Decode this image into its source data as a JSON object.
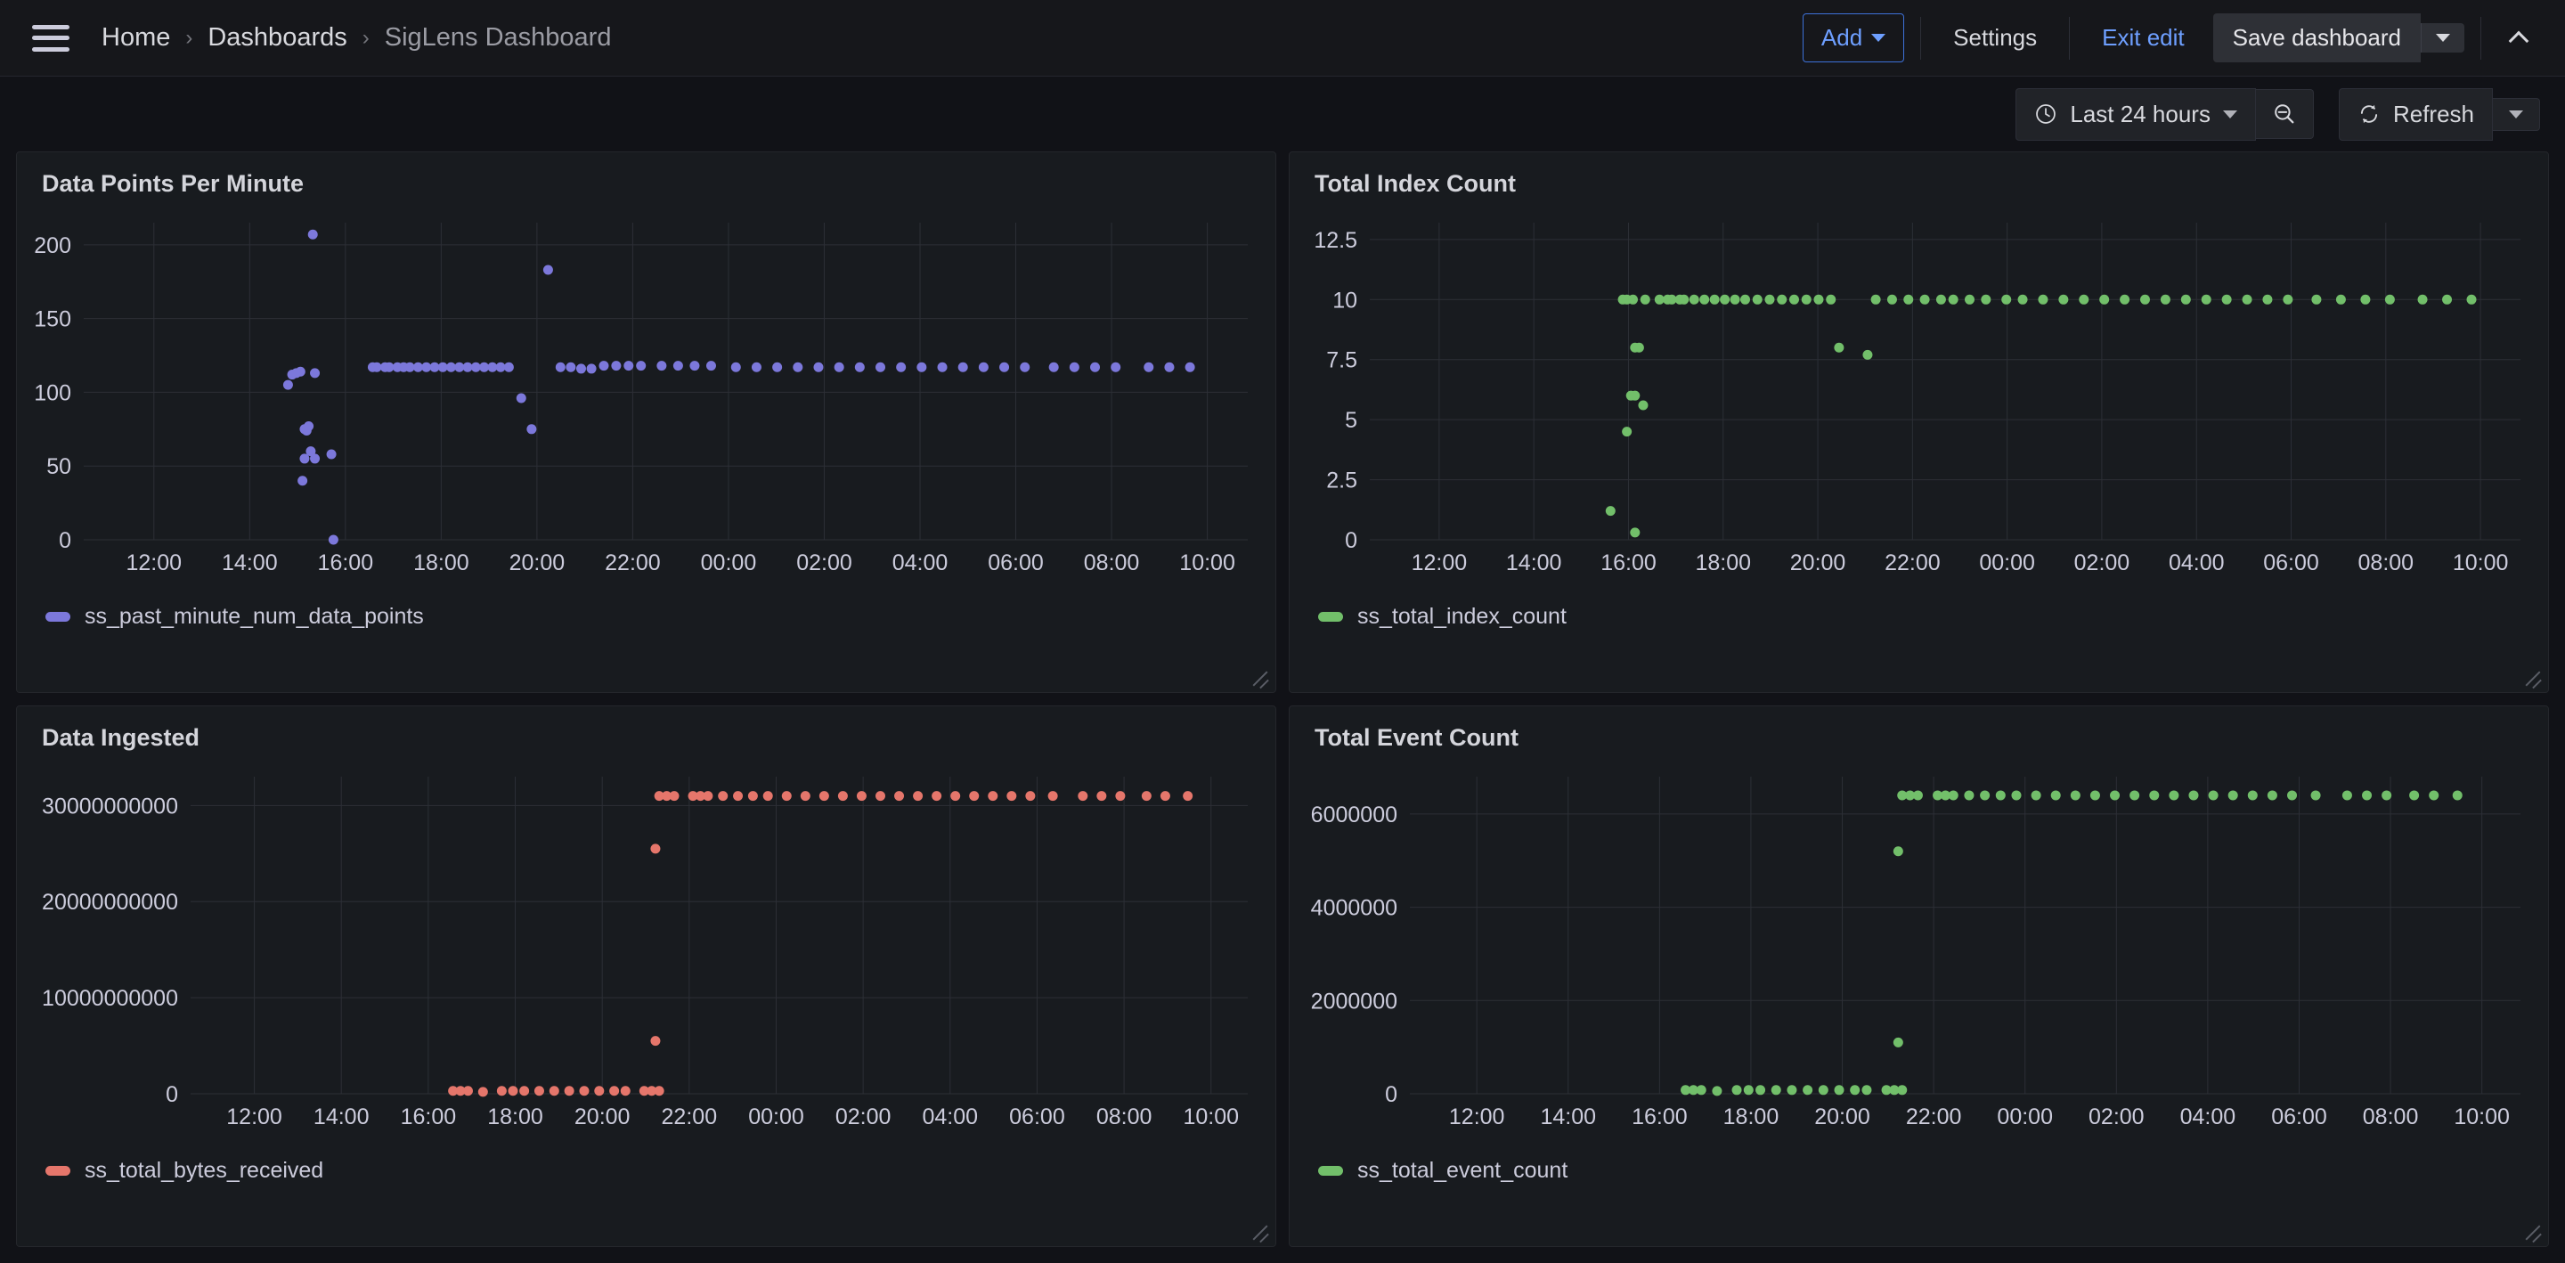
{
  "topbar": {
    "menu_icon": "hamburger-icon",
    "breadcrumb": [
      {
        "label": "Home",
        "active": false
      },
      {
        "label": "Dashboards",
        "active": false
      },
      {
        "label": "SigLens Dashboard",
        "active": true
      }
    ],
    "separator": "›",
    "add_label": "Add",
    "settings_label": "Settings",
    "exit_edit_label": "Exit edit",
    "save_label": "Save dashboard",
    "collapse_icon": "chevron-up-icon"
  },
  "toolbar": {
    "clock_icon": "clock-icon",
    "time_range": "Last 24 hours",
    "zoom_out_icon": "zoom-out-icon",
    "refresh_icon": "refresh-icon",
    "refresh_label": "Refresh"
  },
  "colors": {
    "purple": "#7c78db",
    "green": "#72bf6a",
    "red": "#e5766b",
    "panel_bg": "#181b1f",
    "page_bg": "#111217",
    "grid_line": "#2c2f36",
    "axis_text": "#ccccdc",
    "accent_blue": "#6e9fff"
  },
  "panels": [
    {
      "title": "Data Points Per Minute",
      "legend": "ss_past_minute_num_data_points",
      "color": "#7c78db"
    },
    {
      "title": "Total Index Count",
      "legend": "ss_total_index_count",
      "color": "#72bf6a"
    },
    {
      "title": "Data Ingested",
      "legend": "ss_total_bytes_received",
      "color": "#e5766b"
    },
    {
      "title": "Total Event Count",
      "legend": "ss_total_event_count",
      "color": "#72bf6a"
    }
  ],
  "chart_data": [
    {
      "type": "scatter",
      "title": "Data Points Per Minute",
      "series": [
        {
          "name": "ss_past_minute_num_data_points",
          "color": "#7c78db"
        }
      ],
      "xlabel": "",
      "ylabel": "",
      "xticks": [
        "12:00",
        "14:00",
        "16:00",
        "18:00",
        "20:00",
        "22:00",
        "00:00",
        "02:00",
        "04:00",
        "06:00",
        "08:00",
        "10:00"
      ],
      "yticks": [
        0,
        50,
        100,
        150,
        200
      ],
      "ylim": [
        0,
        215
      ],
      "grid": true,
      "legend_position": "bottom-left",
      "points": [
        [
          15.55,
          207
        ],
        [
          15.05,
          112
        ],
        [
          15.15,
          113
        ],
        [
          15.25,
          114
        ],
        [
          15.6,
          113
        ],
        [
          14.95,
          105
        ],
        [
          15.35,
          75
        ],
        [
          15.45,
          77
        ],
        [
          15.4,
          74
        ],
        [
          15.5,
          60
        ],
        [
          15.35,
          55
        ],
        [
          15.6,
          55
        ],
        [
          16.0,
          58
        ],
        [
          15.3,
          40
        ],
        [
          16.05,
          0
        ],
        [
          21.25,
          183
        ],
        [
          20.6,
          96
        ],
        [
          20.85,
          75
        ],
        [
          17.0,
          117
        ],
        [
          17.1,
          117
        ],
        [
          17.3,
          117
        ],
        [
          17.4,
          117
        ],
        [
          17.6,
          117
        ],
        [
          17.75,
          117
        ],
        [
          17.9,
          117
        ],
        [
          18.1,
          117
        ],
        [
          18.3,
          117
        ],
        [
          18.5,
          117
        ],
        [
          18.7,
          117
        ],
        [
          18.9,
          117
        ],
        [
          19.1,
          117
        ],
        [
          19.3,
          117
        ],
        [
          19.5,
          117
        ],
        [
          19.7,
          117
        ],
        [
          19.9,
          117
        ],
        [
          20.1,
          117
        ],
        [
          20.3,
          117
        ],
        [
          21.55,
          117
        ],
        [
          21.8,
          117
        ],
        [
          22.05,
          116
        ],
        [
          22.3,
          116
        ],
        [
          22.6,
          118
        ],
        [
          22.9,
          118
        ],
        [
          23.2,
          118
        ],
        [
          23.5,
          118
        ],
        [
          24.0,
          118
        ],
        [
          24.4,
          118
        ],
        [
          24.8,
          118
        ],
        [
          25.2,
          118
        ],
        [
          25.8,
          117
        ],
        [
          26.3,
          117
        ],
        [
          26.8,
          117
        ],
        [
          27.3,
          117
        ],
        [
          27.8,
          117
        ],
        [
          28.3,
          117
        ],
        [
          28.8,
          117
        ],
        [
          29.3,
          117
        ],
        [
          29.8,
          117
        ],
        [
          30.3,
          117
        ],
        [
          30.8,
          117
        ],
        [
          31.3,
          117
        ],
        [
          31.8,
          117
        ],
        [
          32.3,
          117
        ],
        [
          32.8,
          117
        ],
        [
          33.5,
          117
        ],
        [
          34.0,
          117
        ],
        [
          34.5,
          117
        ],
        [
          35.0,
          117
        ],
        [
          35.8,
          117
        ],
        [
          36.3,
          117
        ],
        [
          36.8,
          117
        ]
      ]
    },
    {
      "type": "scatter",
      "title": "Total Index Count",
      "series": [
        {
          "name": "ss_total_index_count",
          "color": "#72bf6a"
        }
      ],
      "xticks": [
        "12:00",
        "14:00",
        "16:00",
        "18:00",
        "20:00",
        "22:00",
        "00:00",
        "02:00",
        "04:00",
        "06:00",
        "08:00",
        "10:00"
      ],
      "yticks": [
        0,
        2.5,
        5,
        7.5,
        10,
        12.5
      ],
      "ylim": [
        0,
        13.2
      ],
      "grid": true,
      "legend_position": "bottom-left",
      "points": [
        [
          16.2,
          10
        ],
        [
          16.3,
          10
        ],
        [
          16.45,
          10
        ],
        [
          16.75,
          10
        ],
        [
          17.1,
          10
        ],
        [
          17.3,
          10
        ],
        [
          17.4,
          10
        ],
        [
          17.6,
          10
        ],
        [
          17.7,
          10
        ],
        [
          17.95,
          10
        ],
        [
          18.2,
          10
        ],
        [
          18.45,
          10
        ],
        [
          18.7,
          10
        ],
        [
          18.95,
          10
        ],
        [
          19.2,
          10
        ],
        [
          19.5,
          10
        ],
        [
          19.8,
          10
        ],
        [
          20.1,
          10
        ],
        [
          20.4,
          10
        ],
        [
          20.7,
          10
        ],
        [
          21.0,
          10
        ],
        [
          21.3,
          10
        ],
        [
          22.4,
          10
        ],
        [
          22.8,
          10
        ],
        [
          23.2,
          10
        ],
        [
          23.6,
          10
        ],
        [
          24.0,
          10
        ],
        [
          24.3,
          10
        ],
        [
          24.7,
          10
        ],
        [
          25.1,
          10
        ],
        [
          25.6,
          10
        ],
        [
          26.0,
          10
        ],
        [
          26.5,
          10
        ],
        [
          27.0,
          10
        ],
        [
          27.5,
          10
        ],
        [
          28.0,
          10
        ],
        [
          28.5,
          10
        ],
        [
          29.0,
          10
        ],
        [
          29.5,
          10
        ],
        [
          30.0,
          10
        ],
        [
          30.5,
          10
        ],
        [
          31.0,
          10
        ],
        [
          31.5,
          10
        ],
        [
          32.0,
          10
        ],
        [
          32.5,
          10
        ],
        [
          33.2,
          10
        ],
        [
          33.8,
          10
        ],
        [
          34.4,
          10
        ],
        [
          35.0,
          10
        ],
        [
          35.8,
          10
        ],
        [
          36.4,
          10
        ],
        [
          37.0,
          10
        ],
        [
          16.5,
          8
        ],
        [
          16.6,
          8
        ],
        [
          21.5,
          8
        ],
        [
          22.2,
          7.7
        ],
        [
          16.4,
          6
        ],
        [
          16.5,
          6
        ],
        [
          16.7,
          5.6
        ],
        [
          16.3,
          4.5
        ],
        [
          15.9,
          1.2
        ],
        [
          16.5,
          0.3
        ]
      ]
    },
    {
      "type": "scatter",
      "title": "Data Ingested",
      "series": [
        {
          "name": "ss_total_bytes_received",
          "color": "#e5766b"
        }
      ],
      "xticks": [
        "12:00",
        "14:00",
        "16:00",
        "18:00",
        "20:00",
        "22:00",
        "00:00",
        "02:00",
        "04:00",
        "06:00",
        "08:00",
        "10:00"
      ],
      "yticks": [
        0,
        10000000000,
        20000000000,
        30000000000
      ],
      "ylim": [
        0,
        33000000000
      ],
      "grid": true,
      "legend_position": "bottom-left",
      "points": [
        [
          22.5,
          31000000000
        ],
        [
          22.7,
          31000000000
        ],
        [
          22.9,
          31000000000
        ],
        [
          23.4,
          31000000000
        ],
        [
          23.6,
          31000000000
        ],
        [
          23.8,
          31000000000
        ],
        [
          24.2,
          31000000000
        ],
        [
          24.6,
          31000000000
        ],
        [
          25.0,
          31000000000
        ],
        [
          25.4,
          31000000000
        ],
        [
          25.9,
          31000000000
        ],
        [
          26.4,
          31000000000
        ],
        [
          26.9,
          31000000000
        ],
        [
          27.4,
          31000000000
        ],
        [
          27.9,
          31000000000
        ],
        [
          28.4,
          31000000000
        ],
        [
          28.9,
          31000000000
        ],
        [
          29.4,
          31000000000
        ],
        [
          29.9,
          31000000000
        ],
        [
          30.4,
          31000000000
        ],
        [
          30.9,
          31000000000
        ],
        [
          31.4,
          31000000000
        ],
        [
          31.9,
          31000000000
        ],
        [
          32.4,
          31000000000
        ],
        [
          33.0,
          31000000000
        ],
        [
          33.8,
          31000000000
        ],
        [
          34.3,
          31000000000
        ],
        [
          34.8,
          31000000000
        ],
        [
          35.5,
          31000000000
        ],
        [
          36.0,
          31000000000
        ],
        [
          36.6,
          31000000000
        ],
        [
          22.4,
          25500000000
        ],
        [
          22.4,
          5500000000
        ],
        [
          17.0,
          300000000
        ],
        [
          17.2,
          300000000
        ],
        [
          17.4,
          300000000
        ],
        [
          17.8,
          200000000
        ],
        [
          18.3,
          300000000
        ],
        [
          18.6,
          300000000
        ],
        [
          18.9,
          300000000
        ],
        [
          19.3,
          300000000
        ],
        [
          19.7,
          300000000
        ],
        [
          20.1,
          300000000
        ],
        [
          20.5,
          300000000
        ],
        [
          20.9,
          300000000
        ],
        [
          21.3,
          300000000
        ],
        [
          21.6,
          300000000
        ],
        [
          22.1,
          300000000
        ],
        [
          22.3,
          300000000
        ],
        [
          22.5,
          300000000
        ]
      ]
    },
    {
      "type": "scatter",
      "title": "Total Event Count",
      "series": [
        {
          "name": "ss_total_event_count",
          "color": "#72bf6a"
        }
      ],
      "xticks": [
        "12:00",
        "14:00",
        "16:00",
        "18:00",
        "20:00",
        "22:00",
        "00:00",
        "02:00",
        "04:00",
        "06:00",
        "08:00",
        "10:00"
      ],
      "yticks": [
        0,
        2000000,
        4000000,
        6000000
      ],
      "ylim": [
        0,
        6800000
      ],
      "grid": true,
      "legend_position": "bottom-left",
      "points": [
        [
          22.5,
          6400000
        ],
        [
          22.7,
          6400000
        ],
        [
          22.9,
          6400000
        ],
        [
          23.4,
          6400000
        ],
        [
          23.6,
          6400000
        ],
        [
          23.8,
          6400000
        ],
        [
          24.2,
          6400000
        ],
        [
          24.6,
          6400000
        ],
        [
          25.0,
          6400000
        ],
        [
          25.4,
          6400000
        ],
        [
          25.9,
          6400000
        ],
        [
          26.4,
          6400000
        ],
        [
          26.9,
          6400000
        ],
        [
          27.4,
          6400000
        ],
        [
          27.9,
          6400000
        ],
        [
          28.4,
          6400000
        ],
        [
          28.9,
          6400000
        ],
        [
          29.4,
          6400000
        ],
        [
          29.9,
          6400000
        ],
        [
          30.4,
          6400000
        ],
        [
          30.9,
          6400000
        ],
        [
          31.4,
          6400000
        ],
        [
          31.9,
          6400000
        ],
        [
          32.4,
          6400000
        ],
        [
          33.0,
          6400000
        ],
        [
          33.8,
          6400000
        ],
        [
          34.3,
          6400000
        ],
        [
          34.8,
          6400000
        ],
        [
          35.5,
          6400000
        ],
        [
          36.0,
          6400000
        ],
        [
          36.6,
          6400000
        ],
        [
          22.4,
          5200000
        ],
        [
          22.4,
          1100000
        ],
        [
          17.0,
          80000
        ],
        [
          17.2,
          80000
        ],
        [
          17.4,
          80000
        ],
        [
          17.8,
          60000
        ],
        [
          18.3,
          80000
        ],
        [
          18.6,
          80000
        ],
        [
          18.9,
          80000
        ],
        [
          19.3,
          80000
        ],
        [
          19.7,
          80000
        ],
        [
          20.1,
          80000
        ],
        [
          20.5,
          80000
        ],
        [
          20.9,
          80000
        ],
        [
          21.3,
          80000
        ],
        [
          21.6,
          80000
        ],
        [
          22.1,
          80000
        ],
        [
          22.3,
          80000
        ],
        [
          22.5,
          80000
        ]
      ]
    }
  ]
}
